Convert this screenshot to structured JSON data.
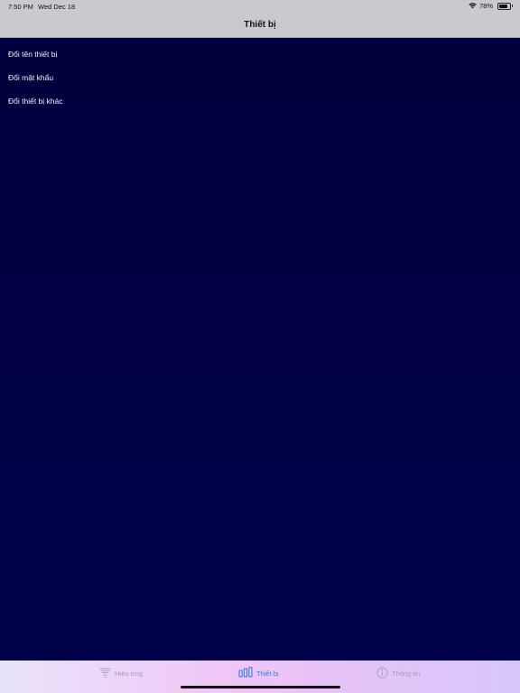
{
  "status_bar": {
    "time": "7:50 PM",
    "date": "Wed Dec 18",
    "battery_percent": "78%",
    "battery_level": 0.78,
    "icons": [
      "wifi-icon",
      "battery-icon"
    ]
  },
  "nav": {
    "title": "Thiết bị"
  },
  "menu": {
    "items": [
      {
        "label": "Đổi tên thiết bị"
      },
      {
        "label": "Đổi mật khẩu"
      },
      {
        "label": "Đổi thiết bị khác"
      }
    ]
  },
  "tabbar": {
    "tabs": [
      {
        "label": "Hiệu ứng",
        "icon": "tornado-icon",
        "active": false
      },
      {
        "label": "Thiết bị",
        "icon": "bars-icon",
        "active": true
      },
      {
        "label": "Thông tin",
        "icon": "info-icon",
        "active": false
      }
    ]
  },
  "colors": {
    "background": "#000040",
    "accent": "#2f7bf2",
    "inactive_tab": "#9aa0b8",
    "glow": "#ff39ff"
  }
}
